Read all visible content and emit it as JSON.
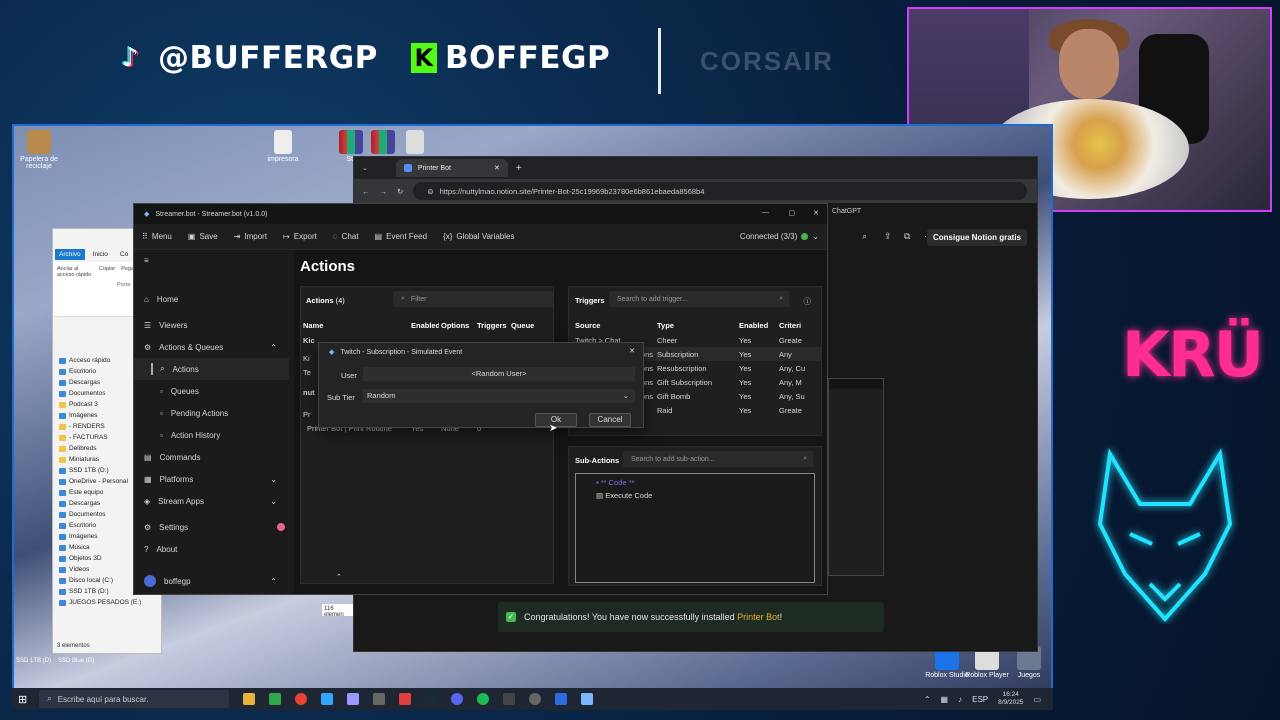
{
  "overlay": {
    "tiktok_handle": "@BUFFERGP",
    "kick_handle": "BOFFEGP",
    "sponsor": "CORSAIR",
    "brand_logo": "KRÜ",
    "cam_border_color": "#d23cff"
  },
  "desktop": {
    "icons": [
      {
        "label": "Papelera de reciclaje"
      },
      {
        "label": "impresora"
      },
      {
        "label": "Str"
      }
    ],
    "right_icons": [
      {
        "label": "Roblox Studio"
      },
      {
        "label": "Roblox Player"
      },
      {
        "label": "Juegos"
      }
    ],
    "bottom_labels": {
      "ssd_1tb": "SSD 1TB (D)",
      "ssd_blue": "SSD Blue (G)"
    }
  },
  "explorer": {
    "tabs": [
      "Archivo",
      "Inicio",
      "Co"
    ],
    "ribbon_labels": {
      "pin": "Anclar al acceso rápido",
      "copy": "Copiar",
      "paste": "Pegar",
      "group": "Porta"
    },
    "items": [
      "Acceso rápido",
      "Escritorio",
      "Descargas",
      "Documentos",
      "Podcast 3",
      "Imágenes",
      "- RENDERS",
      "- FACTURAS",
      "Delibreds",
      "Miniaturas",
      "SSD 1TB (D:)",
      "OneDrive - Personal",
      "Este equipo",
      "Descargas",
      "Documentos",
      "Escritorio",
      "Imágenes",
      "Música",
      "Objetos 3D",
      "Vídeos",
      "Disco local (C:)",
      "SSD 1TB (D:)",
      "JUEGOS PESADOS (E:)"
    ],
    "status": "3 elementos",
    "count_label": "116 elemen"
  },
  "browser": {
    "tab_title": "Printer Bot",
    "url": "https://nuttylmao.notion.site/Printer-Bot-25c19969b23780e6b861ebaeda8568b4",
    "bookmark": "ChatGPT",
    "cta": "Consigue Notion gratis",
    "congrats_prefix": "Congratulations! You have now successfully installed ",
    "congrats_link": "Printer Bot",
    "congrats_suffix": "!"
  },
  "streamerbot": {
    "title": "Streamer.bot - Streamer.bot (v1.0.0)",
    "toolbar": [
      "Menu",
      "Save",
      "Import",
      "Export",
      "Chat",
      "Event Feed",
      "Global Variables"
    ],
    "connection": "Connected (3/3)",
    "nav": [
      {
        "label": "Home",
        "icon": "home-icon"
      },
      {
        "label": "Viewers",
        "icon": "viewers-icon"
      },
      {
        "label": "Actions & Queues",
        "icon": "actions-icon",
        "chev": "^"
      },
      {
        "label": "Actions",
        "sub": true,
        "active": true
      },
      {
        "label": "Queues",
        "sub": true
      },
      {
        "label": "Pending Actions",
        "sub": true
      },
      {
        "label": "Action History",
        "sub": true
      },
      {
        "label": "Commands",
        "icon": "commands-icon"
      },
      {
        "label": "Platforms",
        "icon": "platforms-icon",
        "chev": "v"
      },
      {
        "label": "Stream Apps",
        "icon": "apps-icon",
        "chev": "v"
      },
      {
        "label": "Settings",
        "icon": "gear-icon"
      },
      {
        "label": "About",
        "icon": "about-icon"
      }
    ],
    "user": "boffegp",
    "page_title": "Actions",
    "actions_panel": {
      "header": "Actions",
      "count": "(4)",
      "filter_placeholder": "Filter",
      "columns": [
        "Name",
        "Enabled",
        "Options",
        "Triggers",
        "Queue"
      ],
      "rows": [
        {
          "name": "Kic",
          "enabled": "",
          "options": "",
          "triggers": "",
          "queue": ""
        },
        {
          "name": "Ki",
          "enabled": "",
          "options": "",
          "triggers": "",
          "queue": ""
        },
        {
          "name": "Te",
          "enabled": "",
          "options": "",
          "triggers": "",
          "queue": ""
        },
        {
          "name": "nut",
          "enabled": "",
          "options": "",
          "triggers": "",
          "queue": ""
        },
        {
          "name": "Pr",
          "enabled": "",
          "options": "",
          "triggers": "",
          "queue": ""
        },
        {
          "name": "Printer Bot | Print Routine",
          "enabled": "Yes",
          "options": "None",
          "triggers": "0",
          "queue": ""
        }
      ]
    },
    "triggers_panel": {
      "header": "Triggers",
      "search_placeholder": "Search to add trigger...",
      "columns": [
        "Source",
        "Type",
        "Enabled",
        "Criteri"
      ],
      "rows": [
        {
          "source": "Twitch > Chat",
          "type": "Cheer",
          "enabled": "Yes",
          "criteria": "Greate"
        },
        {
          "source": "ons",
          "type": "Subscription",
          "enabled": "Yes",
          "criteria": "Any"
        },
        {
          "source": "ons",
          "type": "Resubscription",
          "enabled": "Yes",
          "criteria": "Any, Cu"
        },
        {
          "source": "ons",
          "type": "Gift Subscription",
          "enabled": "Yes",
          "criteria": "Any, M"
        },
        {
          "source": "ons",
          "type": "Gift Bomb",
          "enabled": "Yes",
          "criteria": "Any, Su"
        },
        {
          "source": "",
          "type": "Raid",
          "enabled": "Yes",
          "criteria": "Greate"
        }
      ]
    },
    "subactions_panel": {
      "header": "Sub-Actions",
      "search_placeholder": "Search to add sub-action...",
      "items": [
        "** Code **",
        "Execute Code"
      ]
    }
  },
  "dialog": {
    "title": "Twitch - Subscription - Simulated Event",
    "user_label": "User",
    "user_value": "<Random User>",
    "tier_label": "Sub Tier",
    "tier_value": "Random",
    "ok": "Ok",
    "cancel": "Cancel"
  },
  "taskbar": {
    "search_placeholder": "Escribe aquí para buscar.",
    "lang": "ESP",
    "time": "16:24",
    "date": "8/9/2025"
  }
}
